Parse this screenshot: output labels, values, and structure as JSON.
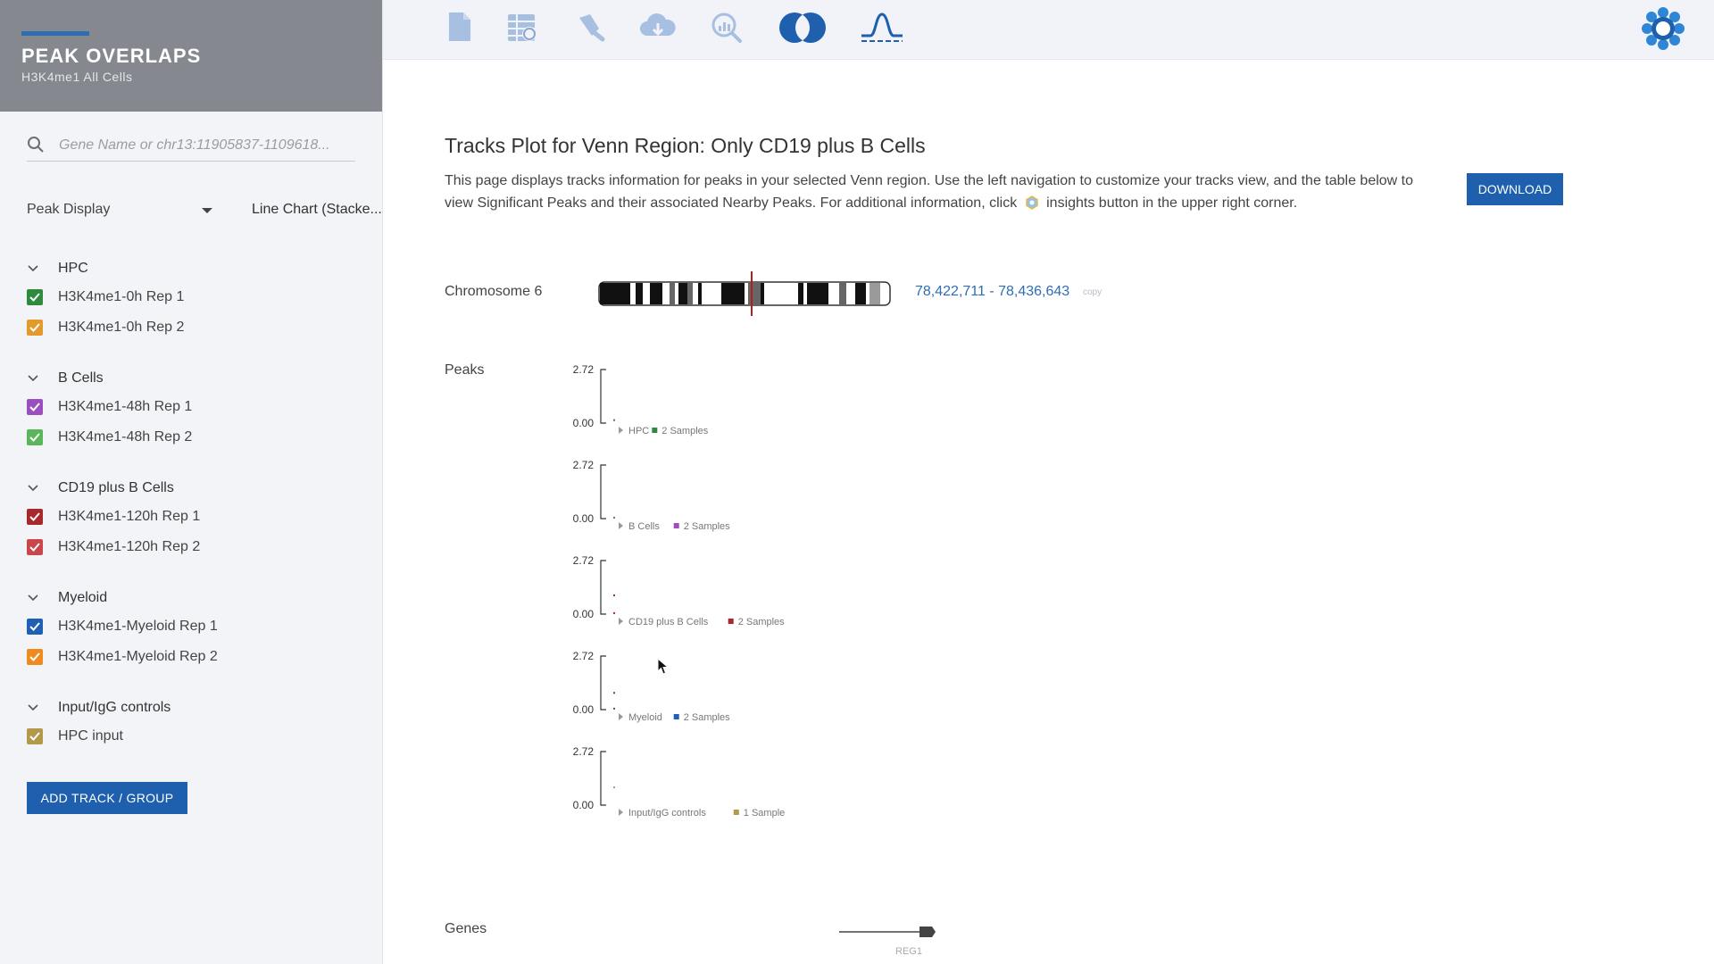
{
  "sidebar": {
    "title": "PEAK OVERLAPS",
    "subtitle": "H3K4me1 All Cells",
    "search_placeholder": "Gene Name or chr13:11905837-1109618...",
    "peak_display_label": "Peak Display",
    "peak_display_value": "Line Chart (Stacke...",
    "groups": [
      {
        "name": "HPC",
        "tracks": [
          {
            "name": "H3K4me1-0h Rep 1",
            "color": "#2e8b3e"
          },
          {
            "name": "H3K4me1-0h Rep 2",
            "color": "#e39a2d"
          }
        ]
      },
      {
        "name": "B Cells",
        "tracks": [
          {
            "name": "H3K4me1-48h Rep 1",
            "color": "#9b4fbf"
          },
          {
            "name": "H3K4me1-48h Rep 2",
            "color": "#5bb65a"
          }
        ]
      },
      {
        "name": "CD19 plus B Cells",
        "tracks": [
          {
            "name": "H3K4me1-120h Rep 1",
            "color": "#a8282c"
          },
          {
            "name": "H3K4me1-120h Rep 2",
            "color": "#c9474a"
          }
        ]
      },
      {
        "name": "Myeloid",
        "tracks": [
          {
            "name": "H3K4me1-Myeloid Rep 1",
            "color": "#1f5fb5"
          },
          {
            "name": "H3K4me1-Myeloid Rep 2",
            "color": "#ee8a1e"
          }
        ]
      },
      {
        "name": "Input/IgG controls",
        "tracks": [
          {
            "name": "HPC input",
            "color": "#b39a4a"
          }
        ]
      }
    ],
    "add_button": "ADD TRACK / GROUP"
  },
  "toolbar": {
    "icons": [
      "document-icon",
      "qc-table-icon",
      "pipette-icon",
      "cloud-download-icon",
      "search-chart-icon",
      "venn-icon",
      "peak-icon"
    ],
    "active_icon": "venn-icon",
    "insights_icon": "insights-icon"
  },
  "main": {
    "title": "Tracks Plot for Venn Region: Only CD19 plus B Cells",
    "description_part1": "This page displays tracks information for peaks in your selected Venn region. Use the left navigation to customize your tracks view, and the table below to view Significant Peaks and their associated Nearby Peaks. For additional information, click",
    "description_part2": "insights button in the upper right corner.",
    "download_label": "DOWNLOAD",
    "chromosome_label": "Chromosome 6",
    "coordinates": "78,422,711 - 78,436,643",
    "copy_label": "copy",
    "peaks_label": "Peaks",
    "genes_label": "Genes",
    "gene_name": "REG1"
  },
  "chart_data": {
    "type": "line",
    "ylim": [
      0,
      2.72
    ],
    "tick_labels": [
      "2.72",
      "0.00"
    ],
    "tracks": [
      {
        "group": "HPC",
        "samples_label": "2 Samples",
        "color": "#2e8b3e",
        "values": [
          0.15
        ]
      },
      {
        "group": "B Cells",
        "samples_label": "2 Samples",
        "color": "#9b4fbf",
        "values": [
          0.05
        ]
      },
      {
        "group": "CD19 plus B Cells",
        "samples_label": "2 Samples",
        "color": "#a8282c",
        "values": [
          0.95,
          0.05
        ]
      },
      {
        "group": "Myeloid",
        "samples_label": "2 Samples",
        "color": "#1f5fb5",
        "values": [
          0.85,
          0.05
        ]
      },
      {
        "group": "Input/IgG controls",
        "samples_label": "1 Sample",
        "color": "#b39a4a",
        "values": [
          0.9
        ]
      }
    ]
  }
}
